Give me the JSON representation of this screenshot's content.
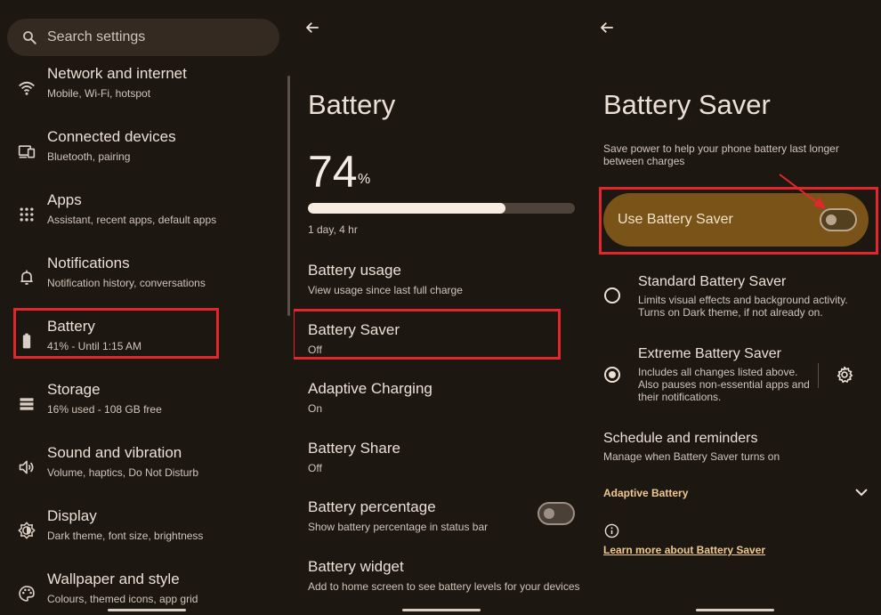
{
  "settings": {
    "search": {
      "placeholder": "Search settings"
    },
    "items": [
      {
        "title": "Network and internet",
        "subtitle": "Mobile, Wi-Fi, hotspot"
      },
      {
        "title": "Connected devices",
        "subtitle": "Bluetooth, pairing"
      },
      {
        "title": "Apps",
        "subtitle": "Assistant, recent apps, default apps"
      },
      {
        "title": "Notifications",
        "subtitle": "Notification history, conversations"
      },
      {
        "title": "Battery",
        "subtitle": "41% - Until 1:15 AM"
      },
      {
        "title": "Storage",
        "subtitle": "16% used - 108 GB free"
      },
      {
        "title": "Sound and vibration",
        "subtitle": "Volume, haptics, Do Not Disturb"
      },
      {
        "title": "Display",
        "subtitle": "Dark theme, font size, brightness"
      },
      {
        "title": "Wallpaper and style",
        "subtitle": "Colours, themed icons, app grid"
      }
    ]
  },
  "battery": {
    "title": "Battery",
    "percent": "74",
    "percent_unit": "%",
    "level_fraction": 0.74,
    "remaining": "1 day, 4 hr",
    "items": [
      {
        "title": "Battery usage",
        "subtitle": "View usage since last full charge"
      },
      {
        "title": "Battery Saver",
        "subtitle": "Off"
      },
      {
        "title": "Adaptive Charging",
        "subtitle": "On"
      },
      {
        "title": "Battery Share",
        "subtitle": "Off"
      },
      {
        "title": "Battery percentage",
        "subtitle": "Show battery percentage in status bar",
        "toggle_on": false
      },
      {
        "title": "Battery widget",
        "subtitle": "Add to home screen to see battery levels for your devices"
      }
    ]
  },
  "battery_saver": {
    "title": "Battery Saver",
    "description": "Save power to help your phone battery last longer between charges",
    "use_label": "Use Battery Saver",
    "use_on": false,
    "options": [
      {
        "title": "Standard Battery Saver",
        "subtitle": "Limits visual effects and background activity. Turns on Dark theme, if not already on.",
        "selected": false
      },
      {
        "title": "Extreme Battery Saver",
        "subtitle": "Includes all changes listed above. Also pauses non-essential apps and their notifications.",
        "selected": true
      }
    ],
    "schedule": {
      "title": "Schedule and reminders",
      "subtitle": "Manage when Battery Saver turns on"
    },
    "adaptive_label": "Adaptive Battery",
    "learn_more": "Learn more about Battery Saver"
  },
  "colors": {
    "background": "#1d1712",
    "accent": "#efc88e",
    "highlight_box": "#e3262b",
    "saver_pill": "#7a5319"
  },
  "icons": [
    "search-icon",
    "wifi-icon",
    "devices-icon",
    "apps-grid-icon",
    "bell-icon",
    "battery-icon",
    "storage-icon",
    "speaker-icon",
    "brightness-icon",
    "palette-icon",
    "back-arrow-icon",
    "gear-icon",
    "chevron-down-icon",
    "info-icon"
  ]
}
